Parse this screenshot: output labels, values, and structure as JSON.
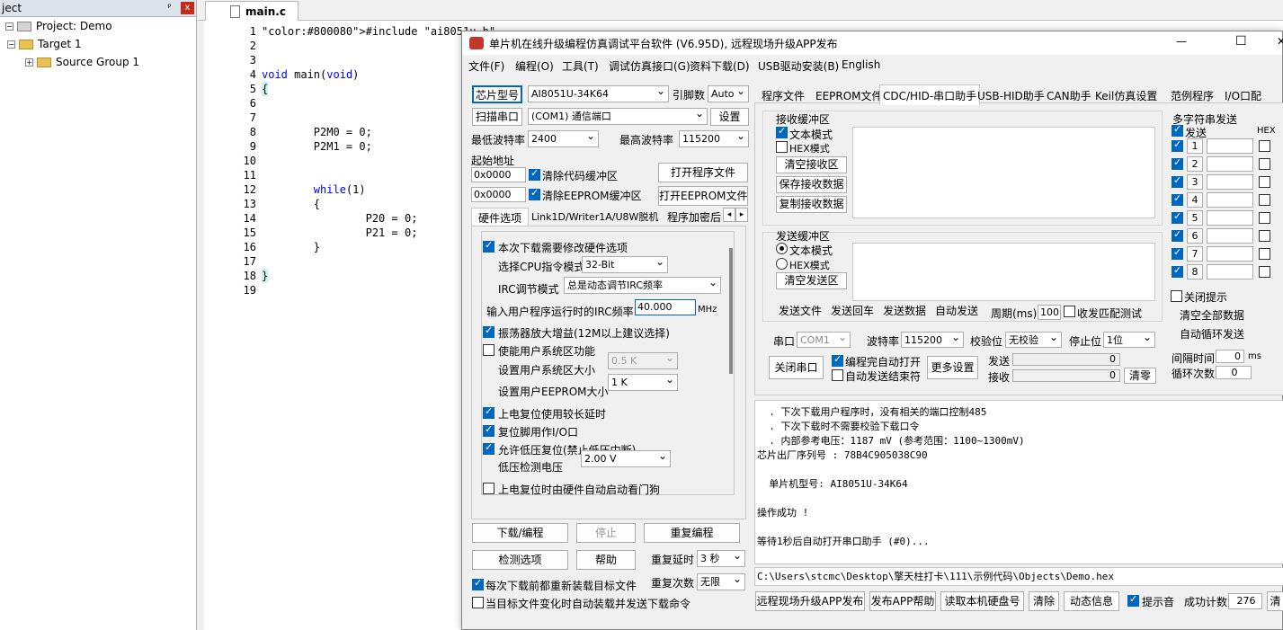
{
  "project": {
    "header": "ject",
    "pin": "ᵖ",
    "close": "x",
    "root": "Project: Demo",
    "target": "Target 1",
    "group": "Source Group 1"
  },
  "editor": {
    "tab": "main.c",
    "line_numbers": [
      "1",
      "2",
      "3",
      "4",
      "5",
      "6",
      "7",
      "8",
      "9",
      "10",
      "11",
      "12",
      "13",
      "14",
      "15",
      "16",
      "17",
      "18",
      "19"
    ],
    "lines": [
      "#include \"ai8051u.h\"",
      "",
      "",
      "void main(void)",
      "{",
      "",
      "",
      "        P2M0 = 0;",
      "        P2M1 = 0;",
      "",
      "",
      "        while(1)",
      "        {",
      "                P20 = 0;",
      "                P21 = 0;",
      "        }",
      "",
      "}",
      ""
    ]
  },
  "window": {
    "title": "单片机在线升级编程仿真调试平台软件 (V6.95D), 远程现场升级APP发布",
    "minimize": "—",
    "maximize": "☐",
    "close": "✕",
    "menu": [
      "文件(F)",
      "编程(O)",
      "工具(T)",
      "调试仿真接口(G)",
      "资料下载(D)",
      "USB驱动安装(B)",
      "English"
    ]
  },
  "left": {
    "chip_btn": "芯片型号",
    "chip": "AI8051U-34K64",
    "pin_label": "引脚数",
    "pin": "Auto",
    "scan_btn": "扫描串口",
    "port": "(COM1) 通信端口",
    "setup_btn": "设置",
    "min_baud_label": "最低波特率",
    "min_baud": "2400",
    "max_baud_label": "最高波特率",
    "max_baud": "115200",
    "start_addr": "起始地址",
    "addr1": "0x0000",
    "clear_code": "清除代码缓冲区",
    "open_prog": "打开程序文件",
    "addr2": "0x0000",
    "clear_eeprom": "清除EEPROM缓冲区",
    "open_eeprom": "打开EEPROM文件",
    "tabs": [
      "硬件选项",
      "Link1D/Writer1A/U8W脱机",
      "程序加密后"
    ],
    "arrows": [
      "◂",
      "▸"
    ],
    "hw": {
      "modify": "本次下载需要修改硬件选项",
      "cpu_label": "选择CPU指令模式",
      "cpu": "32-Bit",
      "irc_label": "IRC调节模式",
      "irc": "总是动态调节IRC频率",
      "freq_label": "输入用户程序运行时的IRC频率",
      "freq": "40.000",
      "mhz": "MHz",
      "osc": "振荡器放大增益(12M以上建议选择)",
      "sys": "使能用户系统区功能",
      "sys_size_label": "设置用户系统区大小",
      "sys_size": "0.5 K",
      "eeprom_label": "设置用户EEPROM大小",
      "eeprom": "1  K",
      "por": "上电复位使用较长延时",
      "rst": "复位脚用作I/O口",
      "lvr": "允许低压复位(禁止低压中断)",
      "lvd_label": "低压检测电压",
      "lvd": "2.00 V",
      "wdt": "上电复位时由硬件自动启动看门狗"
    },
    "download": "下载/编程",
    "stop": "停止",
    "repeat": "重复编程",
    "check": "检测选项",
    "help": "帮助",
    "delay_label": "重复延时",
    "delay": "3 秒",
    "count_label": "重复次数",
    "count": "无限",
    "reload": "每次下载前都重新装载目标文件",
    "auto": "当目标文件变化时自动装载并发送下载命令"
  },
  "right": {
    "tabs": [
      "程序文件",
      "EEPROM文件",
      "CDC/HID-串口助手",
      "USB-HID助手",
      "CAN助手",
      "Keil仿真设置",
      "范例程序",
      "I/O口配"
    ],
    "recv": {
      "title": "接收缓冲区",
      "text": "文本模式",
      "hex": "HEX模式",
      "clear": "清空接收区",
      "save": "保存接收数据",
      "copy": "复制接收数据"
    },
    "send": {
      "title": "发送缓冲区",
      "text": "文本模式",
      "hex": "HEX模式",
      "clear": "清空发送区"
    },
    "bar": {
      "file": "发送文件",
      "enter": "发送回车",
      "data": "发送数据",
      "auto": "自动发送",
      "period_label": "周期(ms)",
      "period": "100",
      "match": "收发匹配测试"
    },
    "serial": {
      "port_label": "串口",
      "port": "COM1",
      "baud_label": "波特率",
      "baud": "115200",
      "parity_label": "校验位",
      "parity": "无校验",
      "stop_label": "停止位",
      "stop": "1位",
      "close": "关闭串口",
      "auto_open": "编程完自动打开",
      "auto_close": "自动发送结束符",
      "more": "更多设置",
      "send_label": "发送",
      "send": "0",
      "recv_label": "接收",
      "recv": "0",
      "clear": "清零"
    },
    "multi": {
      "title": "多字符串发送",
      "send": "发送",
      "hex": "HEX",
      "rows": [
        "1",
        "2",
        "3",
        "4",
        "5",
        "6",
        "7",
        "8"
      ],
      "hint": "关闭提示",
      "clear_all": "清空全部数据",
      "loop": "自动循环发送",
      "interval_label": "间隔时间",
      "interval": "0",
      "ms": "ms",
      "loop_label": "循环次数",
      "loop_count": "0"
    },
    "log": [
      "  . 下次下载用户程序时，没有相关的端口控制485",
      "  . 下次下载时不需要校验下载口令",
      "  . 内部参考电压：1187 mV (参考范围：1100~1300mV)",
      "芯片出厂序列号 : 78B4C905038C90",
      "",
      "  单片机型号: AI8051U-34K64",
      "",
      "操作成功 !",
      "",
      "等待1秒后自动打开串口助手 (#0)..."
    ],
    "path": "C:\\Users\\stcmc\\Desktop\\擎天柱打卡\\111\\示例代码\\Objects\\Demo.hex",
    "bottom": {
      "remote": "远程现场升级APP发布",
      "publish_help": "发布APP帮助",
      "read_disk": "读取本机硬盘号",
      "clear": "清除",
      "dynamic": "动态信息",
      "sound": "提示音",
      "success_label": "成功计数",
      "success": "276",
      "more": "清"
    }
  }
}
